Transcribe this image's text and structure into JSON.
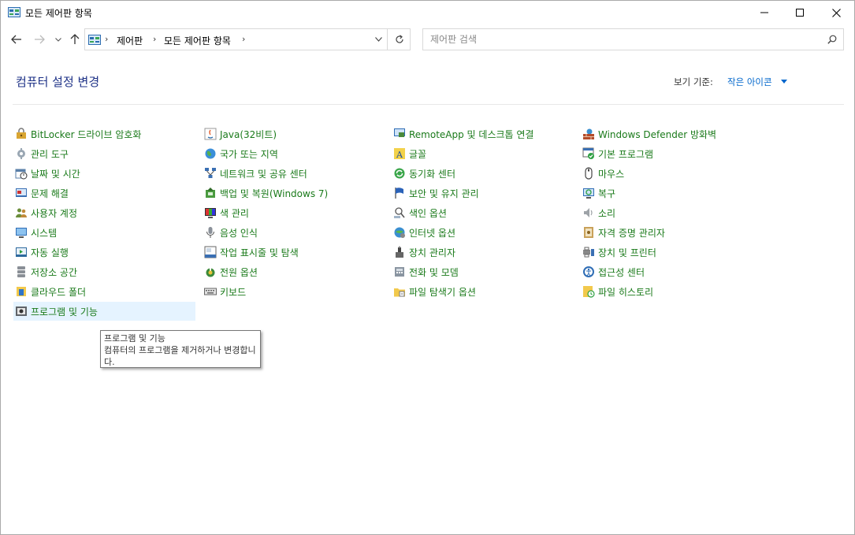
{
  "window": {
    "title": "모든 제어판 항목"
  },
  "address": {
    "crumbs": [
      "제어판",
      "모든 제어판 항목"
    ]
  },
  "search": {
    "placeholder": "제어판 검색"
  },
  "header": {
    "title": "컴퓨터 설정 변경",
    "view_by_label": "보기 기준:",
    "view_by_value": "작은 아이콘"
  },
  "items": [
    {
      "label": "BitLocker 드라이브 암호화",
      "icon": "bitlocker-icon"
    },
    {
      "label": "관리 도구",
      "icon": "admin-tools-icon"
    },
    {
      "label": "날짜 및 시간",
      "icon": "date-time-icon"
    },
    {
      "label": "문제 해결",
      "icon": "troubleshooting-icon"
    },
    {
      "label": "사용자 계정",
      "icon": "user-accounts-icon"
    },
    {
      "label": "시스템",
      "icon": "system-icon"
    },
    {
      "label": "자동 실행",
      "icon": "autoplay-icon"
    },
    {
      "label": "저장소 공간",
      "icon": "storage-spaces-icon"
    },
    {
      "label": "클라우드 폴더",
      "icon": "work-folders-icon"
    },
    {
      "label": "프로그램 및 기능",
      "icon": "programs-features-icon"
    },
    {
      "label": "Java(32비트)",
      "icon": "java-icon"
    },
    {
      "label": "국가 또는 지역",
      "icon": "region-icon"
    },
    {
      "label": "네트워크 및 공유 센터",
      "icon": "network-icon"
    },
    {
      "label": "백업 및 복원(Windows 7)",
      "icon": "backup-icon"
    },
    {
      "label": "색 관리",
      "icon": "color-management-icon"
    },
    {
      "label": "음성 인식",
      "icon": "speech-icon"
    },
    {
      "label": "작업 표시줄 및 탐색",
      "icon": "taskbar-icon"
    },
    {
      "label": "전원 옵션",
      "icon": "power-icon"
    },
    {
      "label": "키보드",
      "icon": "keyboard-icon"
    },
    {
      "label": "RemoteApp 및 데스크톱 연결",
      "icon": "remoteapp-icon"
    },
    {
      "label": "글꼴",
      "icon": "fonts-icon"
    },
    {
      "label": "동기화 센터",
      "icon": "sync-center-icon"
    },
    {
      "label": "보안 및 유지 관리",
      "icon": "security-flag-icon"
    },
    {
      "label": "색인 옵션",
      "icon": "indexing-icon"
    },
    {
      "label": "인터넷 옵션",
      "icon": "internet-options-icon"
    },
    {
      "label": "장치 관리자",
      "icon": "device-manager-icon"
    },
    {
      "label": "전화 및 모뎀",
      "icon": "phone-modem-icon"
    },
    {
      "label": "파일 탐색기 옵션",
      "icon": "folder-options-icon"
    },
    {
      "label": "Windows Defender 방화벽",
      "icon": "firewall-icon"
    },
    {
      "label": "기본 프로그램",
      "icon": "default-programs-icon"
    },
    {
      "label": "마우스",
      "icon": "mouse-icon"
    },
    {
      "label": "복구",
      "icon": "recovery-icon"
    },
    {
      "label": "소리",
      "icon": "sound-icon"
    },
    {
      "label": "자격 증명 관리자",
      "icon": "credential-manager-icon"
    },
    {
      "label": "장치 및 프린터",
      "icon": "devices-printers-icon"
    },
    {
      "label": "접근성 센터",
      "icon": "ease-of-access-icon"
    },
    {
      "label": "파일 히스토리",
      "icon": "file-history-icon"
    }
  ],
  "tooltip": {
    "title": "프로그램 및 기능",
    "description": "컴퓨터의 프로그램을 제거하거나 변경합니다."
  }
}
